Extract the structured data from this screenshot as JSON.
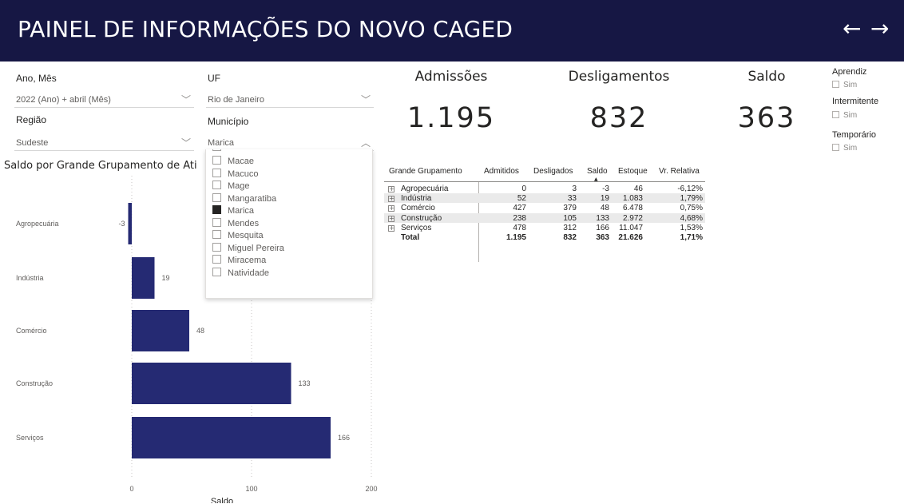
{
  "header": {
    "title": "PAINEL DE INFORMAÇÕES DO NOVO CAGED",
    "back_icon": "←",
    "forward_icon": "→",
    "bg_color": "#161744"
  },
  "filters": {
    "period": {
      "label": "Ano, Mês",
      "value": "2022 (Ano) + abril (Mês)"
    },
    "region": {
      "label": "Região",
      "value": "Sudeste"
    },
    "uf": {
      "label": "UF",
      "value": "Rio de Janeiro"
    },
    "municipio": {
      "label": "Município",
      "value": "Marica",
      "options": [
        "Macae",
        "Macuco",
        "Mage",
        "Mangaratiba",
        "Marica",
        "Mendes",
        "Mesquita",
        "Miguel Pereira",
        "Miracema",
        "Natividade"
      ],
      "selected": "Marica"
    }
  },
  "kpis": [
    {
      "label": "Admissões",
      "value": "1.195"
    },
    {
      "label": "Desligamentos",
      "value": "832"
    },
    {
      "label": "Saldo",
      "value": "363"
    }
  ],
  "side_filters": [
    {
      "label": "Aprendiz",
      "option": "Sim"
    },
    {
      "label": "Intermitente",
      "option": "Sim"
    },
    {
      "label": "Temporário",
      "option": "Sim"
    }
  ],
  "table": {
    "headers": [
      "Grande Grupamento",
      "Admitidos",
      "Desligados",
      "Saldo",
      "Estoque",
      "Vr. Relativa"
    ],
    "rows": [
      [
        "Agropecuária",
        "0",
        "3",
        "-3",
        "46",
        "-6,12%"
      ],
      [
        "Indústria",
        "52",
        "33",
        "19",
        "1.083",
        "1,79%"
      ],
      [
        "Comércio",
        "427",
        "379",
        "48",
        "6.478",
        "0,75%"
      ],
      [
        "Construção",
        "238",
        "105",
        "133",
        "2.972",
        "4,68%"
      ],
      [
        "Serviços",
        "478",
        "312",
        "166",
        "11.047",
        "1,53%"
      ]
    ],
    "total": [
      "Total",
      "1.195",
      "832",
      "363",
      "21.626",
      "1,71%"
    ]
  },
  "chart_data": {
    "type": "bar",
    "orientation": "horizontal",
    "title": "Saldo por Grande Grupamento de Ati",
    "categories": [
      "Agropecuária",
      "Indústria",
      "Comércio",
      "Construção",
      "Serviços"
    ],
    "values": [
      -3,
      19,
      48,
      133,
      166
    ],
    "data_labels": [
      "-3",
      "19",
      "48",
      "133",
      "166"
    ],
    "xlabel": "Saldo",
    "xlim": [
      0,
      200
    ],
    "xticks": [
      "0",
      "100",
      "200"
    ],
    "bar_color": "#252a73",
    "grid": true
  }
}
